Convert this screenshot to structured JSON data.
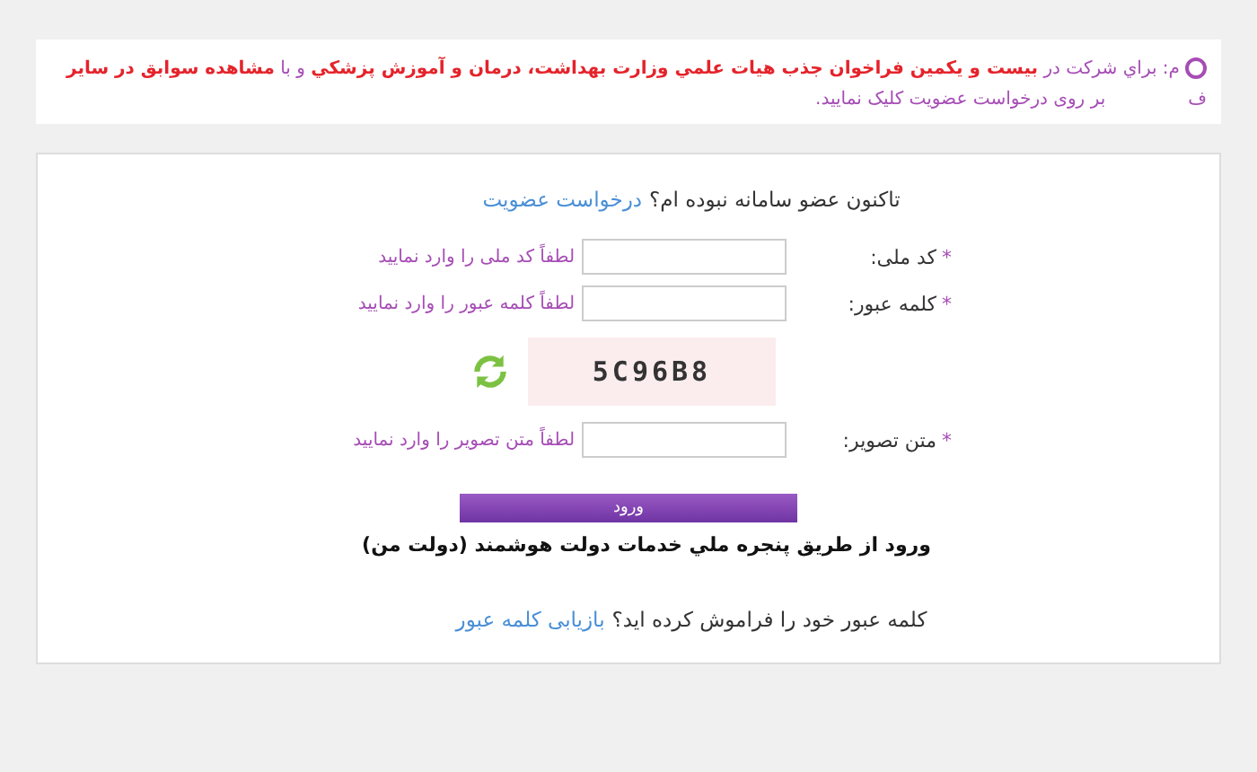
{
  "notice": {
    "lines": [
      "م: براي شركت در **بيست و يكمين فراخوان جذب هيات علمي وزارت بهداشت، درمان و آموزش پزشكي** و با **مشاهده سوابق در ساير**",
      "ف",
      "بر روی درخواست عضویت کلیک نمایید."
    ]
  },
  "signup": {
    "question": "تاکنون عضو سامانه نبوده ام؟",
    "link": "درخواست عضویت"
  },
  "fields": [
    {
      "kind": "input",
      "mark": "*",
      "label": "کد ملی:",
      "hint": "لطفاً کد ملی را وارد نمایید"
    },
    {
      "kind": "input",
      "mark": "*",
      "label": "کلمه عبور:",
      "hint": "لطفاً کلمه عبور را وارد نمایید"
    },
    {
      "kind": "captcha",
      "code": "5C96B8"
    },
    {
      "kind": "input",
      "mark": "*",
      "label": "متن تصویر:",
      "hint": "لطفاً متن تصویر را وارد نمایید"
    }
  ],
  "login_button": "ورود",
  "gov_login": "ورود از طريق پنجره ملي خدمات دولت هوشمند (دولت من)",
  "forgot": {
    "question": "کلمه عبور خود را فراموش کرده اید؟",
    "link": "بازیابی کلمه عبور"
  }
}
